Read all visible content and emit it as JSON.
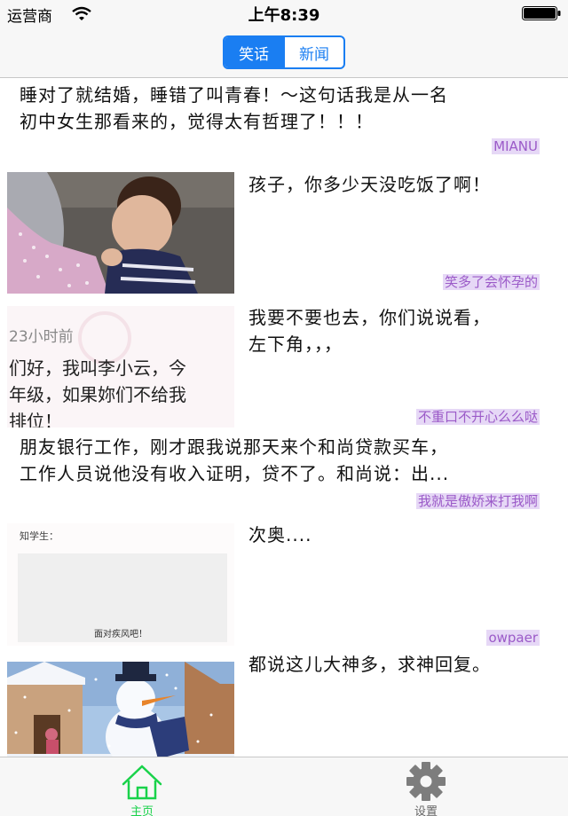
{
  "status_bar": {
    "carrier": "运营商",
    "time": "上午8:39"
  },
  "nav": {
    "segments": [
      {
        "label": "笑话",
        "selected": true
      },
      {
        "label": "新闻",
        "selected": false
      }
    ]
  },
  "feed": [
    {
      "text": "睡对了就结婚，睡错了叫青春！～这句话我是从一名\n初中女生那看来的，觉得太有哲理了！！！",
      "author": "MIANU"
    },
    {
      "text": "孩子，你多少天没吃饭了啊！",
      "author": "笑多了会怀孕的"
    },
    {
      "text": "我要不要也去，你们说说看，\n左下角，，，",
      "author": "不重口不开心么么哒",
      "image_text": {
        "time": "23小时前",
        "line1": "们好，我叫李小云，今",
        "line2": "年级，如果妳们不给我",
        "line3": "排位！"
      }
    },
    {
      "text": "朋友银行工作，刚才跟我说那天来个和尚贷款买车，\n工作人员说他没有收入证明，贷不了。和尚说：出...",
      "author": "我就是傲娇来打我啊"
    },
    {
      "text": "次奥....",
      "author": "owpaer",
      "image_text": {
        "top": "知学生：",
        "caption": "面对疾风吧！"
      }
    },
    {
      "text": "都说这儿大神多，求神回复。",
      "author": ""
    }
  ],
  "tab_bar": {
    "tabs": [
      {
        "label": "主页",
        "icon": "home-icon",
        "selected": true,
        "color": "#19d24a"
      },
      {
        "label": "设置",
        "icon": "gear-icon",
        "selected": false,
        "color": "#666666"
      }
    ]
  },
  "colors": {
    "accent": "#1a7ef2",
    "tag_bg": "#e6d8f6",
    "tag_text": "#9b5ac8",
    "tab_active": "#19d24a"
  }
}
